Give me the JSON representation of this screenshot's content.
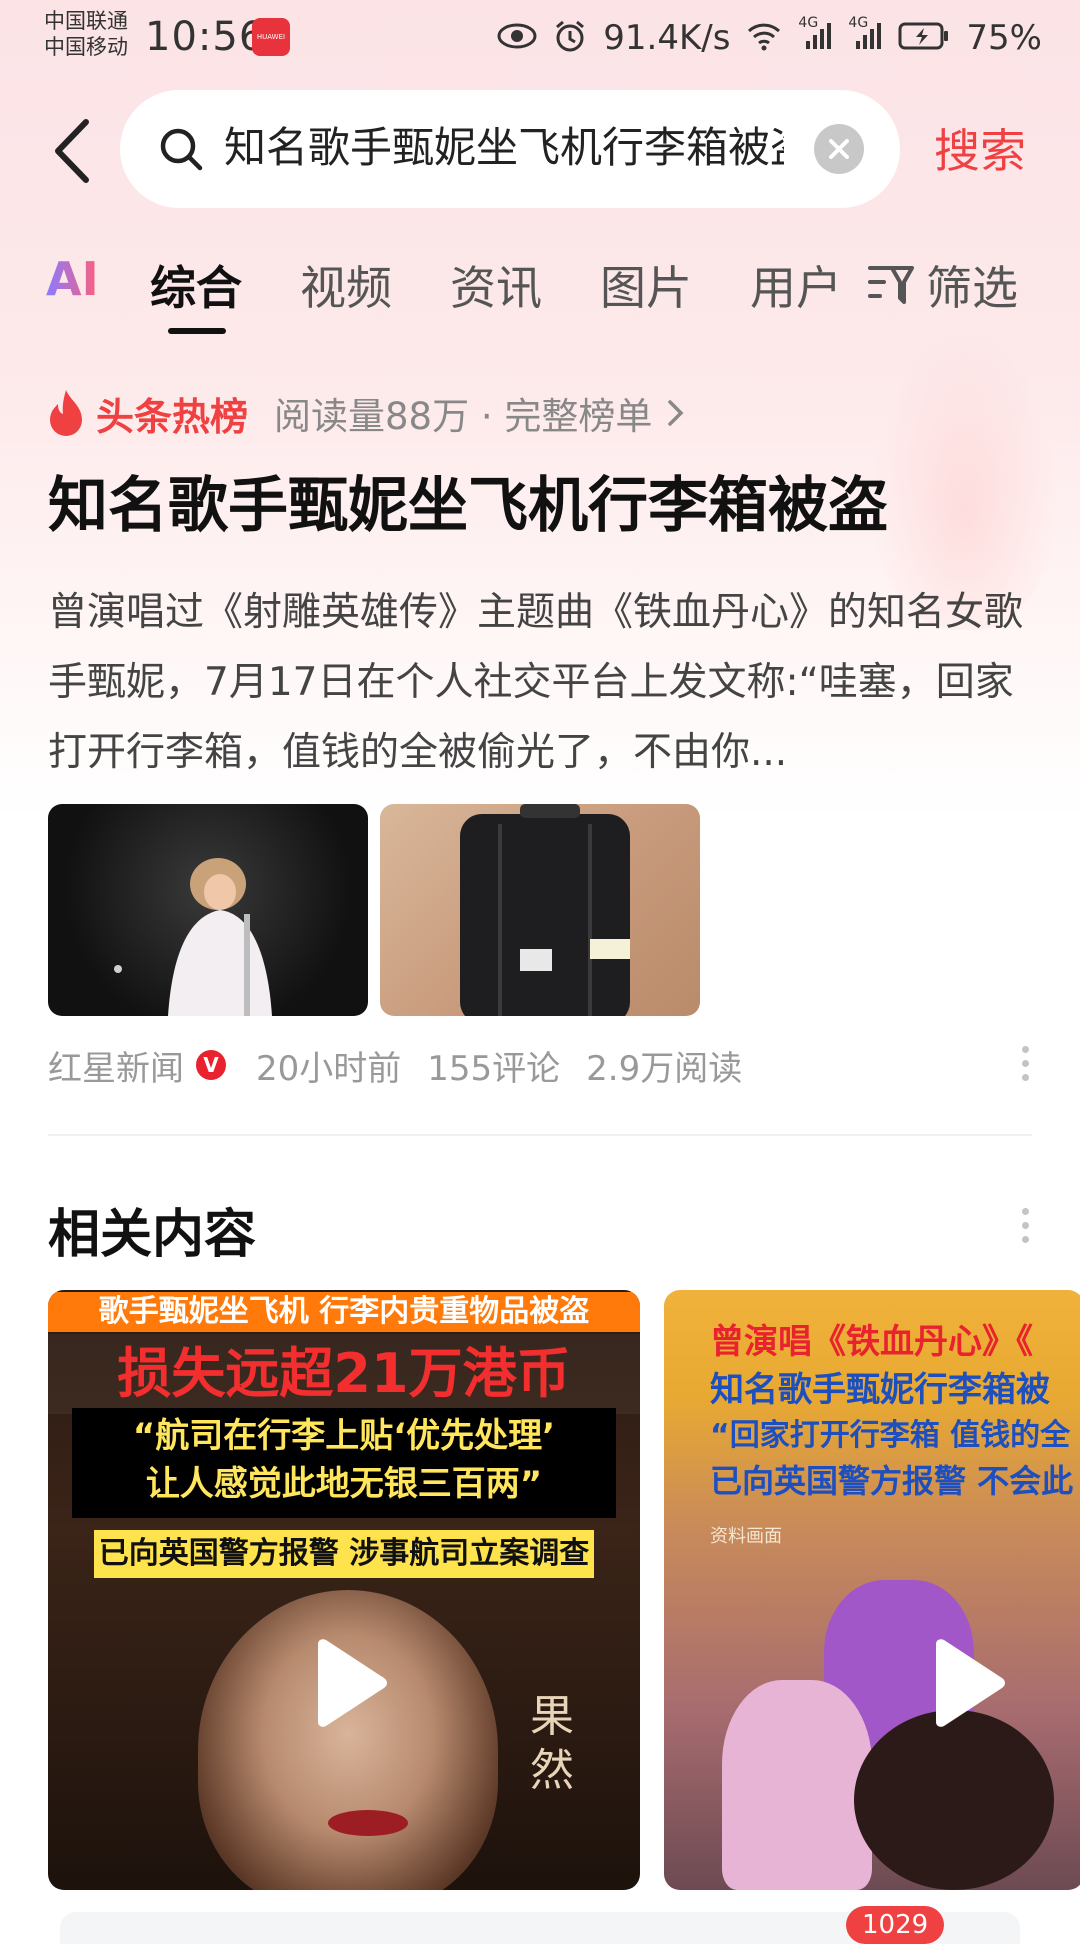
{
  "status_bar": {
    "carrier_1": "中国联通",
    "carrier_2": "中国移动",
    "time": "10:56",
    "app_badge_text": "HUAWEI",
    "net_speed": "91.4K/s",
    "signal_1": "4G",
    "signal_2": "4G",
    "battery": "75%"
  },
  "search": {
    "query": "知名歌手甄妮坐飞机行李箱被盗",
    "button_label": "搜索"
  },
  "tabs": {
    "ai_label": "AI",
    "items": [
      "综合",
      "视频",
      "资讯",
      "图片",
      "用户"
    ],
    "active": "综合",
    "filter_label": "筛选"
  },
  "hot_card": {
    "list_label": "头条热榜",
    "meta": "阅读量88万 · 完整榜单",
    "headline": "知名歌手甄妮坐飞机行李箱被盗",
    "summary": "曾演唱过《射雕英雄传》主题曲《铁血丹心》的知名女歌手甄妮，7月17日在个人社交平台上发文称:“哇塞，回家打开行李箱，值钱的全被偷光了，不由你...",
    "source": "红星新闻",
    "verified_mark": "V",
    "time": "20小时前",
    "comments": "155评论",
    "reads": "2.9万阅读"
  },
  "related": {
    "title": "相关内容",
    "cards": [
      {
        "line1": "歌手甄妮坐飞机 行李内贵重物品被盗",
        "line2": "损失远超21万港币",
        "line3": "“航司在行李上贴‘优先处理’",
        "line4": "让人感觉此地无银三百两”",
        "line5": "已向英国警方报警 涉事航司立案调查",
        "watermark": "果然"
      },
      {
        "line1": "曾演唱《铁血丹心》《",
        "line2": "知名歌手甄妮行李箱被",
        "line3": "“回家打开行李箱 值钱的全",
        "line4": "已向英国警方报警 不会此",
        "small": "资料画面"
      }
    ]
  },
  "bottom": {
    "badge_count": "1029"
  },
  "colors": {
    "accent_red": "#f04142",
    "hot_red": "#f04142",
    "text_dark": "#111111",
    "text_gray": "#999999"
  }
}
